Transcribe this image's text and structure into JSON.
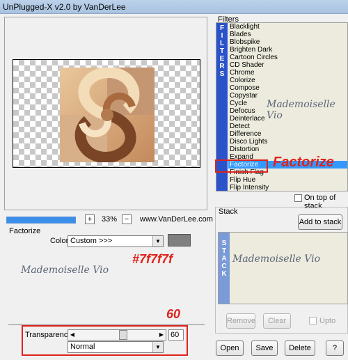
{
  "window": {
    "title": "UnPlugged-X v2.0 by VanDerLee"
  },
  "preview": {
    "zoom_minus_label": "−",
    "zoom_plus_label": "+",
    "zoom_value": "33%",
    "website": "www.VanDerLee.com"
  },
  "settings": {
    "group_title": "Factorize",
    "color_label": "Color",
    "color_select_value": "Custom >>>",
    "swatch_color": "#7f7f7f",
    "watermark": "Mademoiselle Vio",
    "transparency_label": "Transparency",
    "transparency_value": "60",
    "blend_select_value": "Normal"
  },
  "annotations": {
    "filter_name": "Factorize",
    "color_hex": "#7f7f7f",
    "value": "60"
  },
  "filters": {
    "label": "Filters",
    "vtab_letters": [
      "F",
      "I",
      "L",
      "T",
      "E",
      "R",
      "S"
    ],
    "items": [
      "Blacklight",
      "Blades",
      "Blobspike",
      "Brighten Dark",
      "Cartoon Circles",
      "CD Shader",
      "Chrome",
      "Colorize",
      "Compose",
      "Copystar",
      "Cycle",
      "Defocus",
      "Deinterlace",
      "Detect",
      "Difference",
      "Disco Lights",
      "Distortion",
      "Expand",
      "Factorize",
      "Finish Flag",
      "Flip Hue",
      "Flip Intensity"
    ],
    "selected": "Factorize",
    "watermark": "Mademoiselle Vio",
    "on_top_label": "On top of stack"
  },
  "stack": {
    "label": "Stack",
    "add_button": "Add to stack",
    "vtab_letters": [
      "S",
      "T",
      "A",
      "C",
      "K"
    ],
    "watermark": "Mademoiselle Vio",
    "remove_button": "Remove",
    "clear_button": "Clear",
    "upto_label": "Upto"
  },
  "footer": {
    "open": "Open",
    "save": "Save",
    "delete": "Delete",
    "help": "?"
  }
}
